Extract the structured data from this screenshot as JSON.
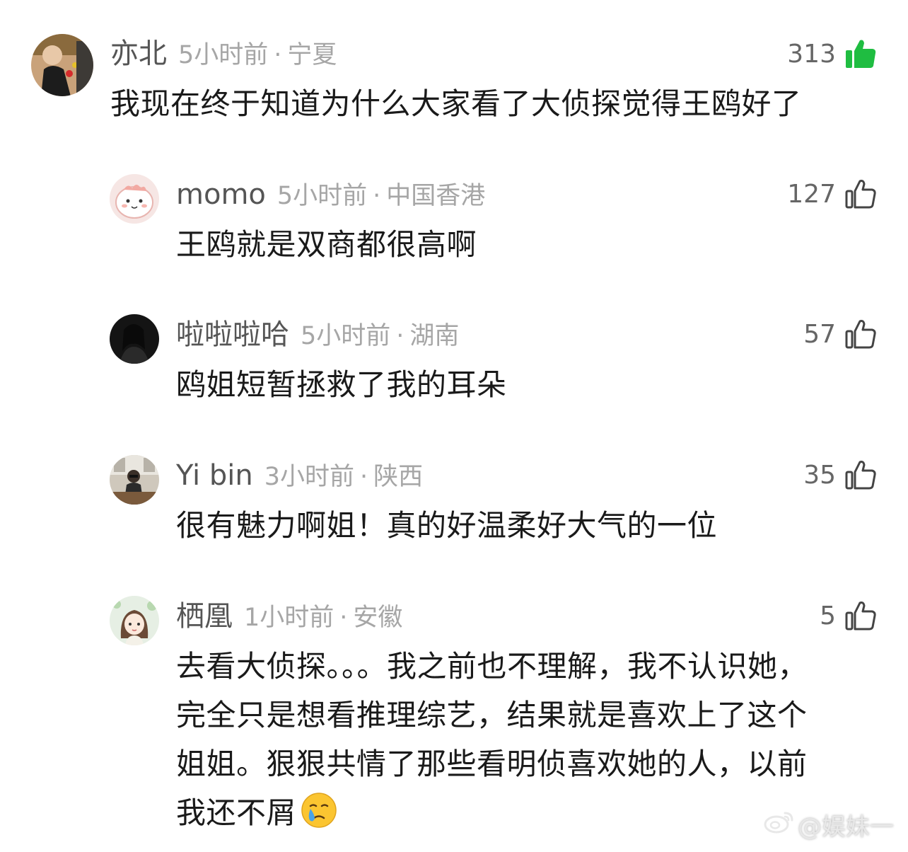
{
  "comments": [
    {
      "name": "亦北",
      "time": "5小时前",
      "location": "宁夏",
      "likes": "313",
      "liked": true,
      "text": "我现在终于知道为什么大家看了大侦探觉得王鸥好了"
    },
    {
      "name": "momo",
      "time": "5小时前",
      "location": "中国香港",
      "likes": "127",
      "liked": false,
      "text": "王鸥就是双商都很高啊"
    },
    {
      "name": "啦啦啦哈",
      "time": "5小时前",
      "location": "湖南",
      "likes": "57",
      "liked": false,
      "text": "鸥姐短暂拯救了我的耳朵"
    },
    {
      "name": "Yi bin",
      "time": "3小时前",
      "location": "陕西",
      "likes": "35",
      "liked": false,
      "text": "很有魅力啊姐！真的好温柔好大气的一位"
    },
    {
      "name": "栖凰",
      "time": "1小时前",
      "location": "安徽",
      "likes": "5",
      "liked": false,
      "text_lines": [
        "去看大侦探。。。我之前也不理解，我不认识她，",
        "完全只是想看推理综艺，结果就是喜欢上了这个",
        "姐姐。狠狠共情了那些看明侦喜欢她的人，以前",
        "我还不屑"
      ],
      "emoji": "crying-face-emoji"
    }
  ],
  "separator": "·",
  "watermark": "@娱妹一",
  "colors": {
    "liked_green": "#1fbd41",
    "name_gray": "#555555",
    "meta_gray": "#a6a6a6",
    "text_black": "#1a1a1a"
  }
}
